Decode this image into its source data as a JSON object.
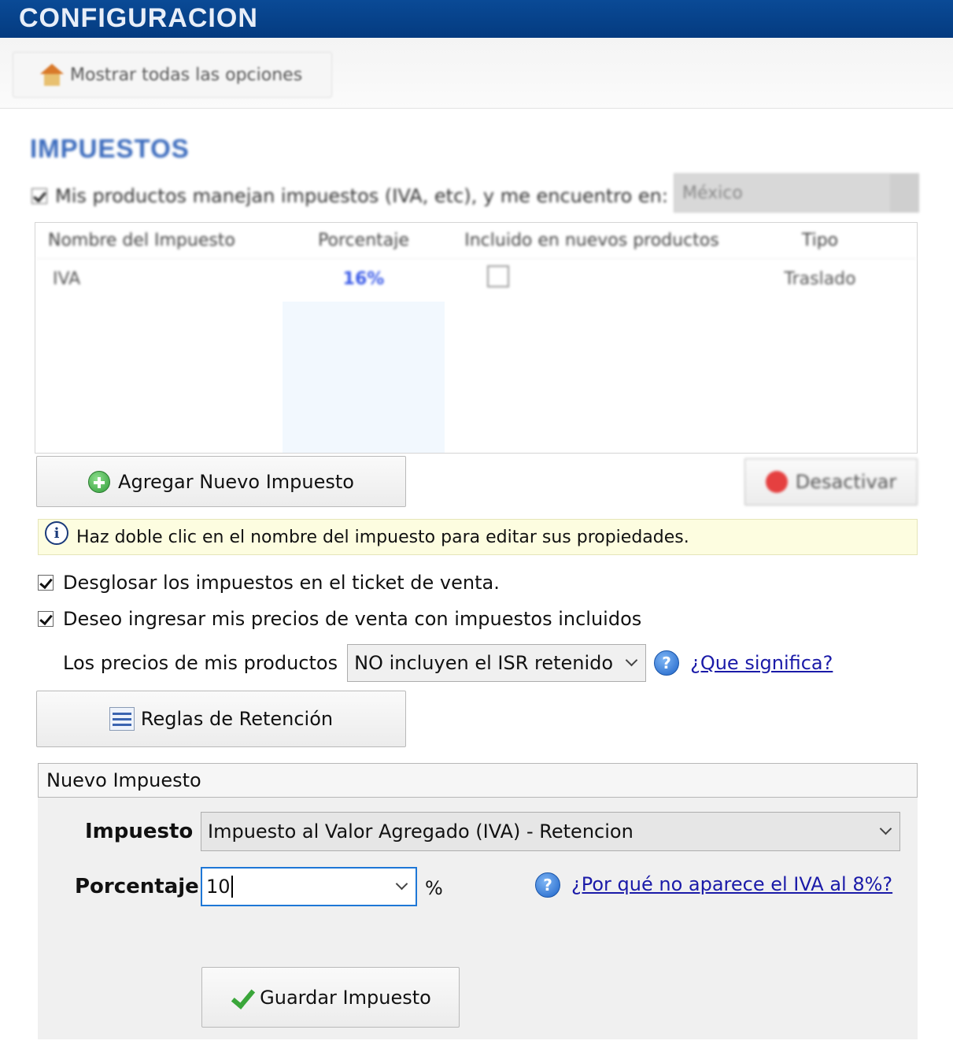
{
  "window": {
    "title": "CONFIGURACION"
  },
  "toolbar": {
    "show_all_label": "Mostrar todas las opciones"
  },
  "section": {
    "title": "IMPUESTOS"
  },
  "taxes_toggle": {
    "label": "Mis productos manejan impuestos (IVA, etc), y me encuentro en:",
    "checked": true,
    "country": "México"
  },
  "tax_table": {
    "columns": [
      "Nombre del Impuesto",
      "Porcentaje",
      "Incluido en nuevos productos",
      "Tipo"
    ],
    "rows": [
      {
        "name": "IVA",
        "percent": "16%",
        "included": false,
        "type": "Traslado"
      }
    ]
  },
  "buttons": {
    "add_tax": "Agregar Nuevo Impuesto",
    "deactivate": "Desactivar",
    "retention_rules": "Reglas de Retención",
    "save_tax": "Guardar Impuesto"
  },
  "hint": {
    "text": "Haz doble clic en el nombre del impuesto para editar sus propiedades."
  },
  "options": {
    "breakdown_label": "Desglosar los impuestos en el ticket de venta.",
    "prices_with_taxes_label": "Deseo ingresar mis precios de venta con impuestos incluidos"
  },
  "prices": {
    "label": "Los precios de mis productos",
    "selected": "NO incluyen el ISR retenido",
    "help_link": "¿Que significa?"
  },
  "new_tax": {
    "header": "Nuevo Impuesto",
    "tax_label": "Impuesto",
    "tax_selected": "Impuesto al Valor Agregado (IVA) - Retencion",
    "percent_label": "Porcentaje",
    "percent_value": "10",
    "percent_unit": "%",
    "help_link": "¿Por qué no aparece el IVA al 8%?"
  },
  "colors": {
    "titlebar": "#043b80",
    "link": "#1a1aa8",
    "hint_bg": "#fdfde0",
    "input_focus": "#1e77d6"
  }
}
